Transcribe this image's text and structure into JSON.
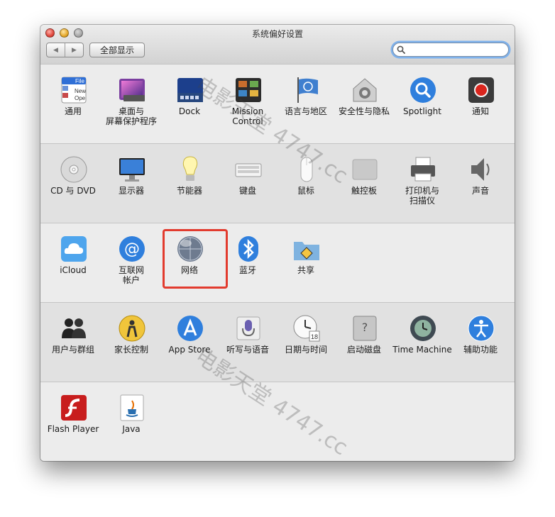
{
  "window": {
    "title": "系统偏好设置",
    "nav": {
      "back_glyph": "◀",
      "forward_glyph": "▶"
    },
    "show_all_label": "全部显示",
    "search": {
      "value": "",
      "placeholder": ""
    }
  },
  "rows": [
    {
      "items": [
        {
          "label": "通用",
          "icon": "general-icon"
        },
        {
          "label": "桌面与\n屏幕保护程序",
          "icon": "desktop-screensaver-icon"
        },
        {
          "label": "Dock",
          "icon": "dock-icon"
        },
        {
          "label": "Mission\nControl",
          "icon": "mission-control-icon"
        },
        {
          "label": "语言与地区",
          "icon": "language-region-icon"
        },
        {
          "label": "安全性与隐私",
          "icon": "security-privacy-icon"
        },
        {
          "label": "Spotlight",
          "icon": "spotlight-icon"
        },
        {
          "label": "通知",
          "icon": "notifications-icon"
        }
      ]
    },
    {
      "items": [
        {
          "label": "CD 与 DVD",
          "icon": "cd-dvd-icon"
        },
        {
          "label": "显示器",
          "icon": "displays-icon"
        },
        {
          "label": "节能器",
          "icon": "energy-saver-icon"
        },
        {
          "label": "键盘",
          "icon": "keyboard-icon"
        },
        {
          "label": "鼠标",
          "icon": "mouse-icon"
        },
        {
          "label": "触控板",
          "icon": "trackpad-icon"
        },
        {
          "label": "打印机与\n扫描仪",
          "icon": "printers-scanners-icon"
        },
        {
          "label": "声音",
          "icon": "sound-icon"
        }
      ]
    },
    {
      "items": [
        {
          "label": "iCloud",
          "icon": "icloud-icon"
        },
        {
          "label": "互联网\n帐户",
          "icon": "internet-accounts-icon"
        },
        {
          "label": "网络",
          "icon": "network-icon"
        },
        {
          "label": "蓝牙",
          "icon": "bluetooth-icon"
        },
        {
          "label": "共享",
          "icon": "sharing-icon"
        }
      ]
    },
    {
      "items": [
        {
          "label": "用户与群组",
          "icon": "users-groups-icon"
        },
        {
          "label": "家长控制",
          "icon": "parental-controls-icon"
        },
        {
          "label": "App Store",
          "icon": "app-store-icon"
        },
        {
          "label": "听写与语音",
          "icon": "dictation-speech-icon"
        },
        {
          "label": "日期与时间",
          "icon": "date-time-icon"
        },
        {
          "label": "启动磁盘",
          "icon": "startup-disk-icon"
        },
        {
          "label": "Time Machine",
          "icon": "time-machine-icon"
        },
        {
          "label": "辅助功能",
          "icon": "accessibility-icon"
        }
      ]
    },
    {
      "items": [
        {
          "label": "Flash Player",
          "icon": "flash-player-icon"
        },
        {
          "label": "Java",
          "icon": "java-icon"
        }
      ]
    }
  ],
  "datetime_icon_day": "18",
  "general_icon_text": {
    "line1": "File",
    "line2": "New",
    "line3": "Ope"
  },
  "watermark": "电影天堂 4747.cc"
}
